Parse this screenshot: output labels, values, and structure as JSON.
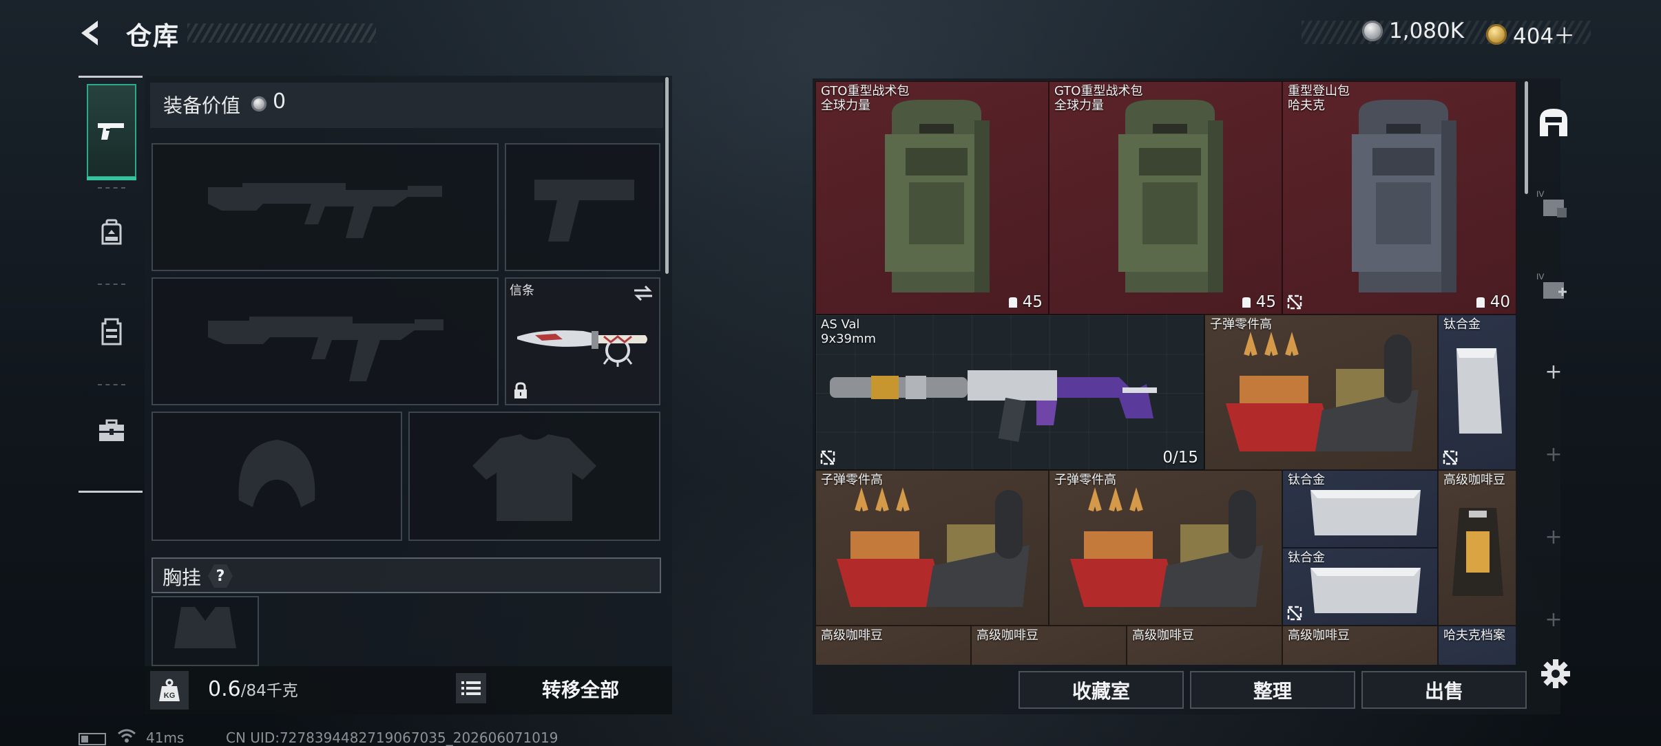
{
  "header": {
    "title": "仓库",
    "currency_silver": "1,080K",
    "currency_gold": "404＋"
  },
  "left_tabs": [
    {
      "icon": "pistol-icon",
      "active": true
    },
    {
      "icon": "backpack-icon",
      "active": false
    },
    {
      "icon": "chest-rig-icon",
      "active": false
    },
    {
      "icon": "toolbox-icon",
      "active": false
    }
  ],
  "equipment": {
    "value_label": "装备价值",
    "value": "0",
    "melee_label": "信条",
    "chest_label": "胸挂",
    "chest_help": "?"
  },
  "weight": {
    "current": "0.6",
    "max": "/84千克",
    "icon_label": "KG"
  },
  "transfer_all": "转移全部",
  "storage_items": [
    {
      "id": "bag1",
      "name": "GTO重型战术包\n全球力量",
      "count": "45",
      "count_icon": "backpack-small-icon",
      "color": "red"
    },
    {
      "id": "bag2",
      "name": "GTO重型战术包\n全球力量",
      "count": "45",
      "count_icon": "backpack-small-icon",
      "color": "red"
    },
    {
      "id": "bag3",
      "name": "重型登山包\n哈夫克",
      "count": "40",
      "count_icon": "backpack-small-icon",
      "color": "red"
    },
    {
      "id": "asval",
      "name": "AS Val\n9x39mm",
      "count": "0/15",
      "color": "grey"
    },
    {
      "id": "ammo1",
      "name": "子弹零件高",
      "color": "brown"
    },
    {
      "id": "ti1",
      "name": "钛合金",
      "color": "blue"
    },
    {
      "id": "ammo2",
      "name": "子弹零件高",
      "color": "brown"
    },
    {
      "id": "ammo3",
      "name": "子弹零件高",
      "color": "brown"
    },
    {
      "id": "ti2",
      "name": "钛合金",
      "color": "blue"
    },
    {
      "id": "ti3",
      "name": "钛合金",
      "color": "blue"
    },
    {
      "id": "coffee1",
      "name": "高级咖啡豆",
      "color": "brown"
    },
    {
      "id": "coffee2",
      "name": "高级咖啡豆",
      "color": "brown"
    },
    {
      "id": "coffee3",
      "name": "高级咖啡豆",
      "color": "brown"
    },
    {
      "id": "coffee4",
      "name": "高级咖啡豆",
      "color": "brown"
    },
    {
      "id": "coffee5",
      "name": "高级咖啡豆",
      "color": "brown"
    },
    {
      "id": "archive",
      "name": "哈夫克档案",
      "color": "blue"
    }
  ],
  "bottom_buttons": {
    "collection": "收藏室",
    "organize": "整理",
    "sell": "出售"
  },
  "status": {
    "ping": "41ms",
    "uid": "CN UID:7278394482719067035_202606071019"
  }
}
